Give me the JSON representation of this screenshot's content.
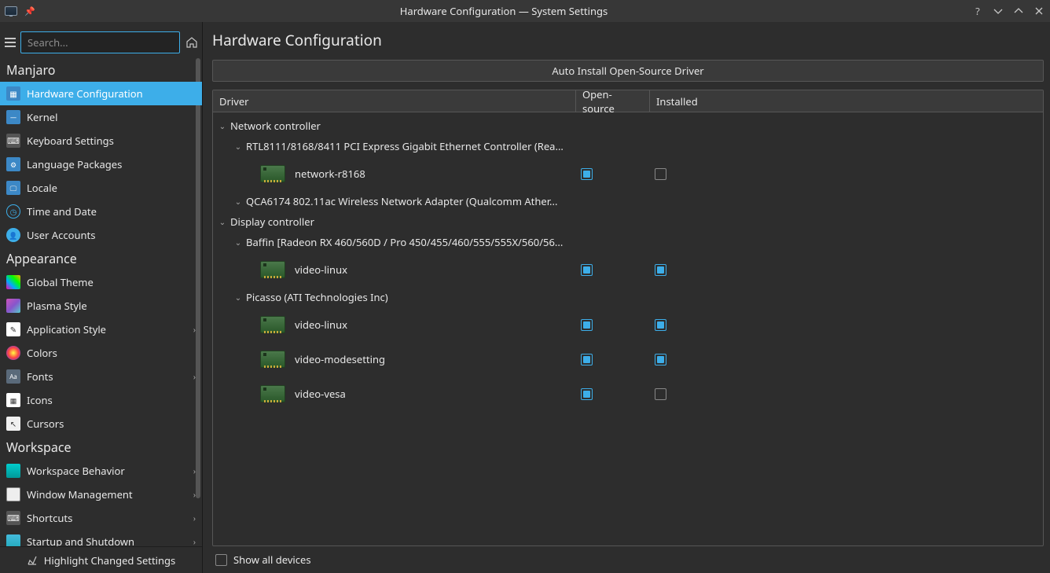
{
  "titlebar": {
    "title": "Hardware Configuration — System Settings"
  },
  "toolbar": {
    "search_placeholder": "Search..."
  },
  "sidebar": {
    "sections": [
      {
        "title": "Manjaro",
        "items": [
          {
            "label": "Hardware Configuration",
            "icon": "ic-hw",
            "active": true,
            "chev": false
          },
          {
            "label": "Kernel",
            "icon": "ic-kernel",
            "chev": false
          },
          {
            "label": "Keyboard Settings",
            "icon": "ic-kbd",
            "chev": false
          },
          {
            "label": "Language Packages",
            "icon": "ic-lang",
            "chev": false
          },
          {
            "label": "Locale",
            "icon": "ic-locale",
            "chev": false
          },
          {
            "label": "Time and Date",
            "icon": "ic-time",
            "chev": false
          },
          {
            "label": "User Accounts",
            "icon": "ic-user",
            "chev": false
          }
        ]
      },
      {
        "title": "Appearance",
        "items": [
          {
            "label": "Global Theme",
            "icon": "ic-theme",
            "chev": false
          },
          {
            "label": "Plasma Style",
            "icon": "ic-plasma",
            "chev": false
          },
          {
            "label": "Application Style",
            "icon": "ic-appstyle",
            "chev": true
          },
          {
            "label": "Colors",
            "icon": "ic-colors",
            "chev": false
          },
          {
            "label": "Fonts",
            "icon": "ic-fonts",
            "chev": true
          },
          {
            "label": "Icons",
            "icon": "ic-icons",
            "chev": false
          },
          {
            "label": "Cursors",
            "icon": "ic-cursors",
            "chev": false
          }
        ]
      },
      {
        "title": "Workspace",
        "items": [
          {
            "label": "Workspace Behavior",
            "icon": "ic-wsb",
            "chev": true
          },
          {
            "label": "Window Management",
            "icon": "ic-wm",
            "chev": true
          },
          {
            "label": "Shortcuts",
            "icon": "ic-sc",
            "chev": true
          },
          {
            "label": "Startup and Shutdown",
            "icon": "ic-ss",
            "chev": true
          }
        ]
      }
    ],
    "footer_label": "Highlight Changed Settings"
  },
  "content": {
    "title": "Hardware Configuration",
    "auto_button": "Auto Install Open-Source Driver",
    "columns": {
      "driver": "Driver",
      "opensource": "Open-source",
      "installed": "Installed"
    },
    "tree": [
      {
        "label": "Network controller",
        "items": [
          {
            "label": "RTL8111/8168/8411 PCI Express Gigabit Ethernet Controller (Rea...",
            "drivers": [
              {
                "name": "network-r8168",
                "os": true,
                "inst": false
              }
            ]
          },
          {
            "label": "QCA6174 802.11ac Wireless Network Adapter (Qualcomm Ather...",
            "drivers": []
          }
        ]
      },
      {
        "label": "Display controller",
        "items": [
          {
            "label": "Baffin [Radeon RX 460/560D / Pro 450/455/460/555/555X/560/56...",
            "drivers": [
              {
                "name": "video-linux",
                "os": true,
                "inst": true
              }
            ]
          },
          {
            "label": "Picasso (ATI Technologies Inc)",
            "drivers": [
              {
                "name": "video-linux",
                "os": true,
                "inst": true
              },
              {
                "name": "video-modesetting",
                "os": true,
                "inst": true
              },
              {
                "name": "video-vesa",
                "os": true,
                "inst": false
              }
            ]
          }
        ]
      }
    ],
    "show_all_label": "Show all devices"
  }
}
